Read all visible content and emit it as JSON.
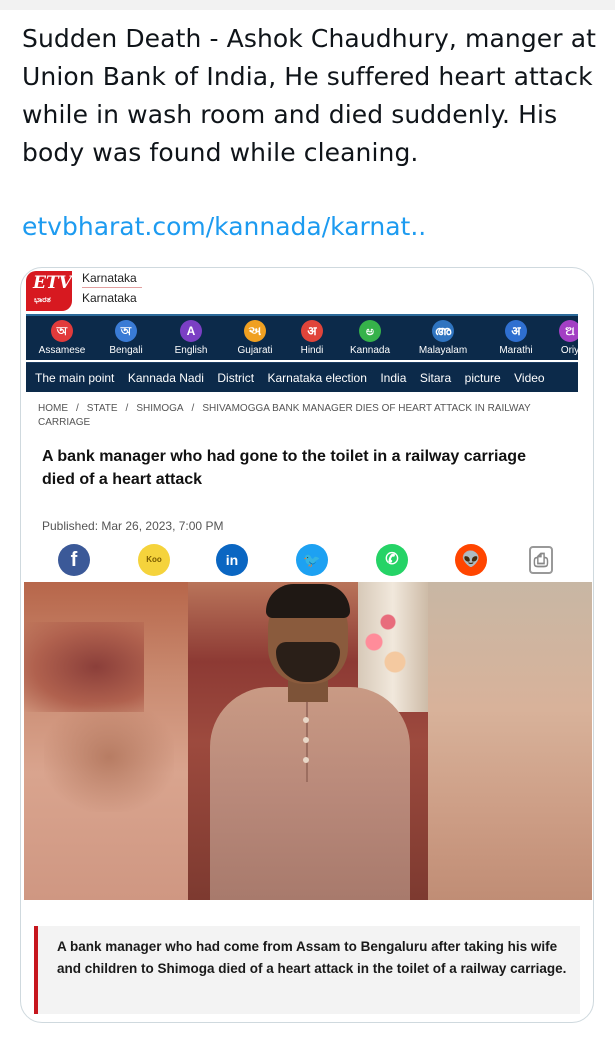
{
  "tweet": {
    "text": "Sudden Death - Ashok Chaudhury, manger at Union Bank of India, He suffered heart attack while in wash room and died suddenly. His body was found while cleaning.",
    "link": "etvbharat.com/kannada/karnat.."
  },
  "card": {
    "brand": {
      "logo_text": "ETV",
      "logo_subtext": "ಭಾರತ",
      "line1": "Karnataka",
      "line2": "Karnataka"
    },
    "languages": [
      {
        "glyph": "অ",
        "label": "Assamese",
        "color": "#e23b3b"
      },
      {
        "glyph": "অ",
        "label": "Bengali",
        "color": "#3a7bd5"
      },
      {
        "glyph": "A",
        "label": "English",
        "color": "#7b3fc4"
      },
      {
        "glyph": "અ",
        "label": "Gujarati",
        "color": "#f0a021"
      },
      {
        "glyph": "अ",
        "label": "Hindi",
        "color": "#e0443a"
      },
      {
        "glyph": "ಅ",
        "label": "Kannada",
        "color": "#36b24a"
      },
      {
        "glyph": "അ",
        "label": "Malayalam",
        "color": "#2f74c0"
      },
      {
        "glyph": "अ",
        "label": "Marathi",
        "color": "#2f6fd0"
      },
      {
        "glyph": "ଅ",
        "label": "Oriy",
        "color": "#a33fc4"
      }
    ],
    "nav": [
      "The main point",
      "Kannada Nadi",
      "District",
      "Karnataka election",
      "India",
      "Sitara",
      "picture",
      "Video"
    ],
    "breadcrumb": [
      "HOME",
      "STATE",
      "SHIMOGA",
      "SHIVAMOGGA BANK MANAGER DIES OF HEART ATTACK IN RAILWAY CARRIAGE"
    ],
    "headline": "A bank manager who had gone to the toilet in a railway carriage died of a heart attack",
    "published": "Published: Mar 26, 2023, 7:00 PM",
    "share": [
      {
        "name": "facebook-icon",
        "glyph": "f",
        "color": "#3b5998"
      },
      {
        "name": "koo-icon",
        "glyph": "Koo",
        "color": "#f5d33c"
      },
      {
        "name": "linkedin-icon",
        "glyph": "in",
        "color": "#0a66c2"
      },
      {
        "name": "twitter-icon",
        "glyph": "🐦",
        "color": "#1da1f2"
      },
      {
        "name": "whatsapp-icon",
        "glyph": "✆",
        "color": "#25d366"
      },
      {
        "name": "reddit-icon",
        "glyph": "👽",
        "color": "#ff4500"
      },
      {
        "name": "print-icon",
        "glyph": "⎙",
        "color": "#ffffff"
      }
    ],
    "caption": "A bank manager who had come from Assam to Bengaluru after taking his wife and children to Shimoga died of a heart attack in the toilet of a railway carriage."
  }
}
